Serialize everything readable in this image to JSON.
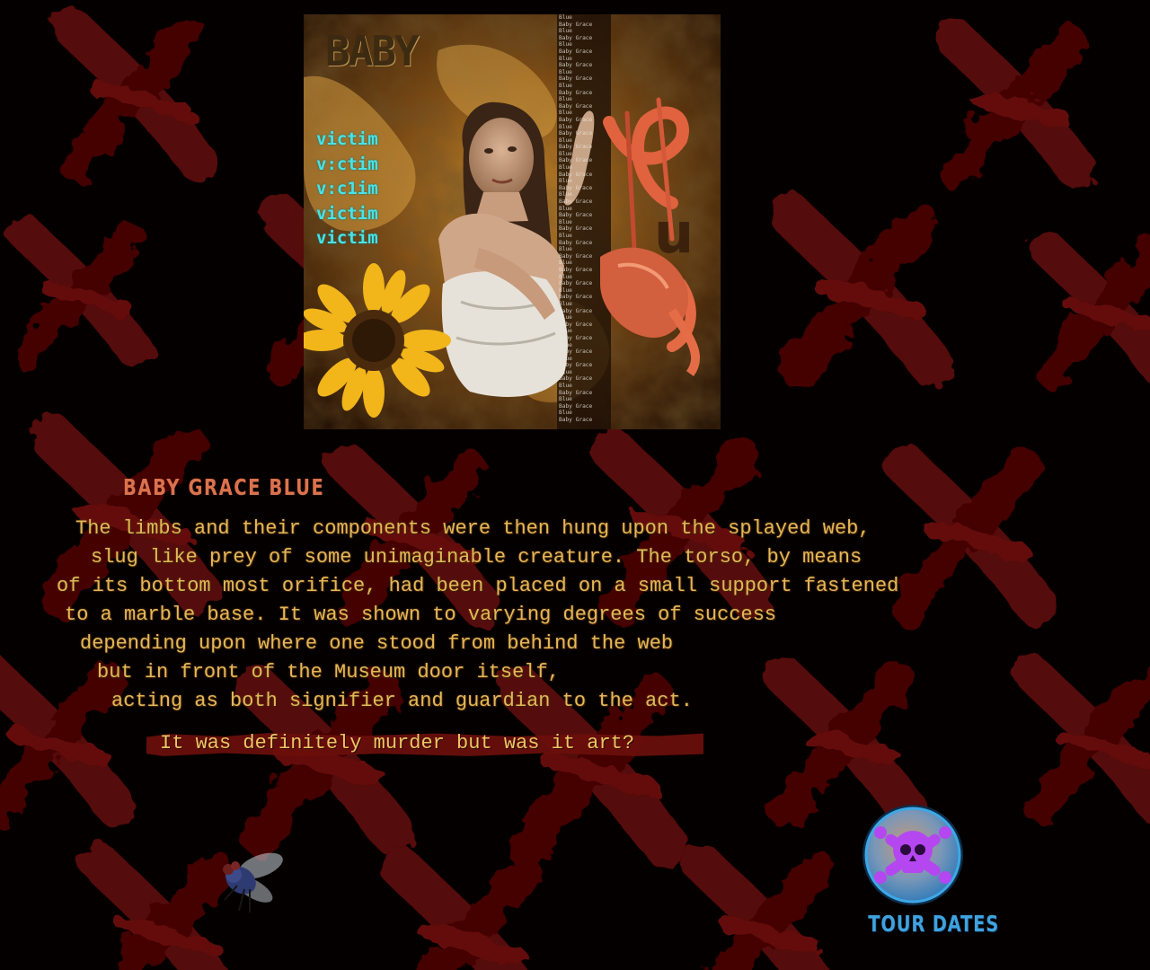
{
  "hero": {
    "big_word": "BABY",
    "words": [
      "victim",
      "v:ctim",
      "v:c1im",
      "victim",
      "victim"
    ],
    "side_text_lines": [
      "Blue",
      "Baby Grace",
      "Blue",
      "Baby Grace",
      "Blue",
      "Baby Grace",
      "Blue",
      "Baby Grace",
      "Blue",
      "Baby Grace",
      "Blue",
      "Baby Grace",
      "Blue",
      "Baby Grace",
      "Blue",
      "Baby Grace",
      "Blue",
      "Baby Grace",
      "Blue",
      "Baby Grace",
      "Blue",
      "Baby Grace",
      "Blue",
      "Baby Grace",
      "Blue",
      "Baby Grace",
      "Blue",
      "Baby Grace",
      "Blue",
      "Baby Grace",
      "Blue",
      "Baby Grace",
      "Blue",
      "Baby Grace",
      "Blue",
      "Baby Grace",
      "Blue",
      "Baby Grace",
      "Blue",
      "Baby Grace",
      "Blue",
      "Baby Grace",
      "Blue",
      "Baby Grace",
      "Blue",
      "Baby Grace",
      "Blue",
      "Baby Grace",
      "Blue",
      "Baby Grace",
      "Blue",
      "Baby Grace",
      "Blue",
      "Baby Grace",
      "Blue",
      "Baby Grace",
      "Blue",
      "Baby Grace",
      "Blue",
      "Baby Grace"
    ]
  },
  "title": "BABY GRACE BLUE",
  "story_lines": [
    "The limbs and their components were then hung upon the splayed web,",
    "slug like prey of some unimaginable creature. The torso, by means",
    "of its bottom most orifice, had been placed on a small support fastened",
    "to a marble base. It was shown to varying degrees of success",
    "depending upon where one stood from behind the web",
    "but in front of the Museum door itself,",
    "acting as both signifier and guardian to the act."
  ],
  "question": "It was definitely murder but was it art?",
  "tour": {
    "label": "TOUR DATES",
    "icon": "skull-crossbones-icon"
  },
  "fly_icon": "fly-icon",
  "colors": {
    "background": "#050000",
    "brush": "#5a0707",
    "story_text": "#e2b85a",
    "title": "#d9734e",
    "question_band": "#6b0f0b",
    "victim_words": "#49e3e6",
    "tour_label": "#3fa2df",
    "skull": "#b447f0"
  }
}
